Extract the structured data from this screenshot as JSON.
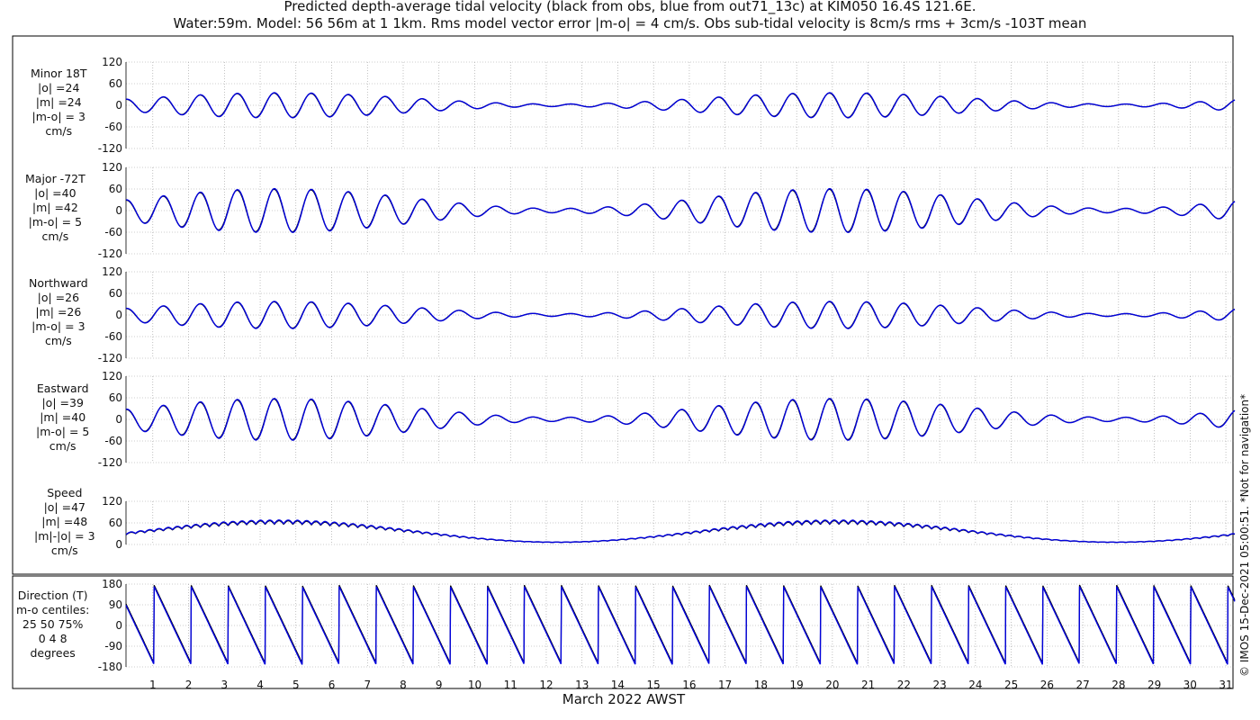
{
  "title": {
    "line1": "Predicted depth-average tidal velocity (black from obs, blue from out71_13c) at KIM050 16.4S 121.6E.",
    "line2": "Water:59m. Model: 56 56m at 1 1km. Rms model vector error |m-o| = 4 cm/s. Obs sub-tidal velocity is 8cm/s rms + 3cm/s -103T mean"
  },
  "xlabel": "March 2022 AWST",
  "copyright": "© IMOS 15-Dec-2021 05:00:51. *Not for navigation*",
  "colors": {
    "obs": "#000000",
    "model": "#0000dd",
    "grid": "#999999"
  },
  "panels": [
    {
      "label_lines": [
        "Minor 18T",
        "|o| =24",
        "|m| =24",
        "|m-o| = 3",
        "cm/s"
      ]
    },
    {
      "label_lines": [
        "Major -72T",
        "|o| =40",
        "|m| =42",
        "|m-o| = 5",
        "cm/s"
      ]
    },
    {
      "label_lines": [
        "Northward",
        "|o| =26",
        "|m| =26",
        "|m-o| = 3",
        "cm/s"
      ]
    },
    {
      "label_lines": [
        "Eastward",
        "|o| =39",
        "|m| =40",
        "|m-o| = 5",
        "cm/s"
      ]
    },
    {
      "label_lines": [
        "Speed",
        "|o| =47",
        "|m| =48",
        "|m|-|o| = 3",
        "cm/s"
      ]
    },
    {
      "label_lines": [
        "Direction (T)",
        "m-o centiles:",
        "25  50  75%",
        "0   4   8",
        "degrees"
      ]
    }
  ],
  "chart_data": [
    {
      "type": "line",
      "title": "Minor 18T",
      "xlim": [
        0.25,
        31.25
      ],
      "ylim": [
        -120,
        120
      ],
      "yticks": [
        120,
        60,
        0,
        -60,
        -120
      ],
      "amplitude_rms": {
        "obs": 24,
        "model": 24
      },
      "series": [
        {
          "name": "obs"
        },
        {
          "name": "model"
        }
      ]
    },
    {
      "type": "line",
      "title": "Major -72T",
      "xlim": [
        0.25,
        31.25
      ],
      "ylim": [
        -120,
        120
      ],
      "yticks": [
        120,
        60,
        0,
        -60,
        -120
      ],
      "amplitude_rms": {
        "obs": 40,
        "model": 42
      },
      "series": [
        {
          "name": "obs"
        },
        {
          "name": "model"
        }
      ]
    },
    {
      "type": "line",
      "title": "Northward",
      "xlim": [
        0.25,
        31.25
      ],
      "ylim": [
        -120,
        120
      ],
      "yticks": [
        120,
        60,
        0,
        -60,
        -120
      ],
      "amplitude_rms": {
        "obs": 26,
        "model": 26
      },
      "series": [
        {
          "name": "obs"
        },
        {
          "name": "model"
        }
      ]
    },
    {
      "type": "line",
      "title": "Eastward",
      "xlim": [
        0.25,
        31.25
      ],
      "ylim": [
        -120,
        120
      ],
      "yticks": [
        120,
        60,
        0,
        -60,
        -120
      ],
      "amplitude_rms": {
        "obs": 39,
        "model": 40
      },
      "series": [
        {
          "name": "obs"
        },
        {
          "name": "model"
        }
      ]
    },
    {
      "type": "line",
      "title": "Speed",
      "xlim": [
        0.25,
        31.25
      ],
      "ylim": [
        0,
        120
      ],
      "yticks": [
        120,
        60,
        0
      ],
      "amplitude_rms": {
        "obs": 47,
        "model": 48
      },
      "series": [
        {
          "name": "obs"
        },
        {
          "name": "model"
        }
      ]
    },
    {
      "type": "line",
      "title": "Direction (T)",
      "xlim": [
        0.25,
        31.25
      ],
      "ylim": [
        -180,
        180
      ],
      "yticks": [
        180,
        90,
        0,
        -90,
        -180
      ],
      "series": [
        {
          "name": "obs"
        },
        {
          "name": "model"
        }
      ]
    }
  ],
  "x_axis": {
    "ticks": [
      1,
      2,
      3,
      4,
      5,
      6,
      7,
      8,
      9,
      10,
      11,
      12,
      13,
      14,
      15,
      16,
      17,
      18,
      19,
      20,
      21,
      22,
      23,
      24,
      25,
      26,
      27,
      28,
      29,
      30,
      31
    ]
  }
}
